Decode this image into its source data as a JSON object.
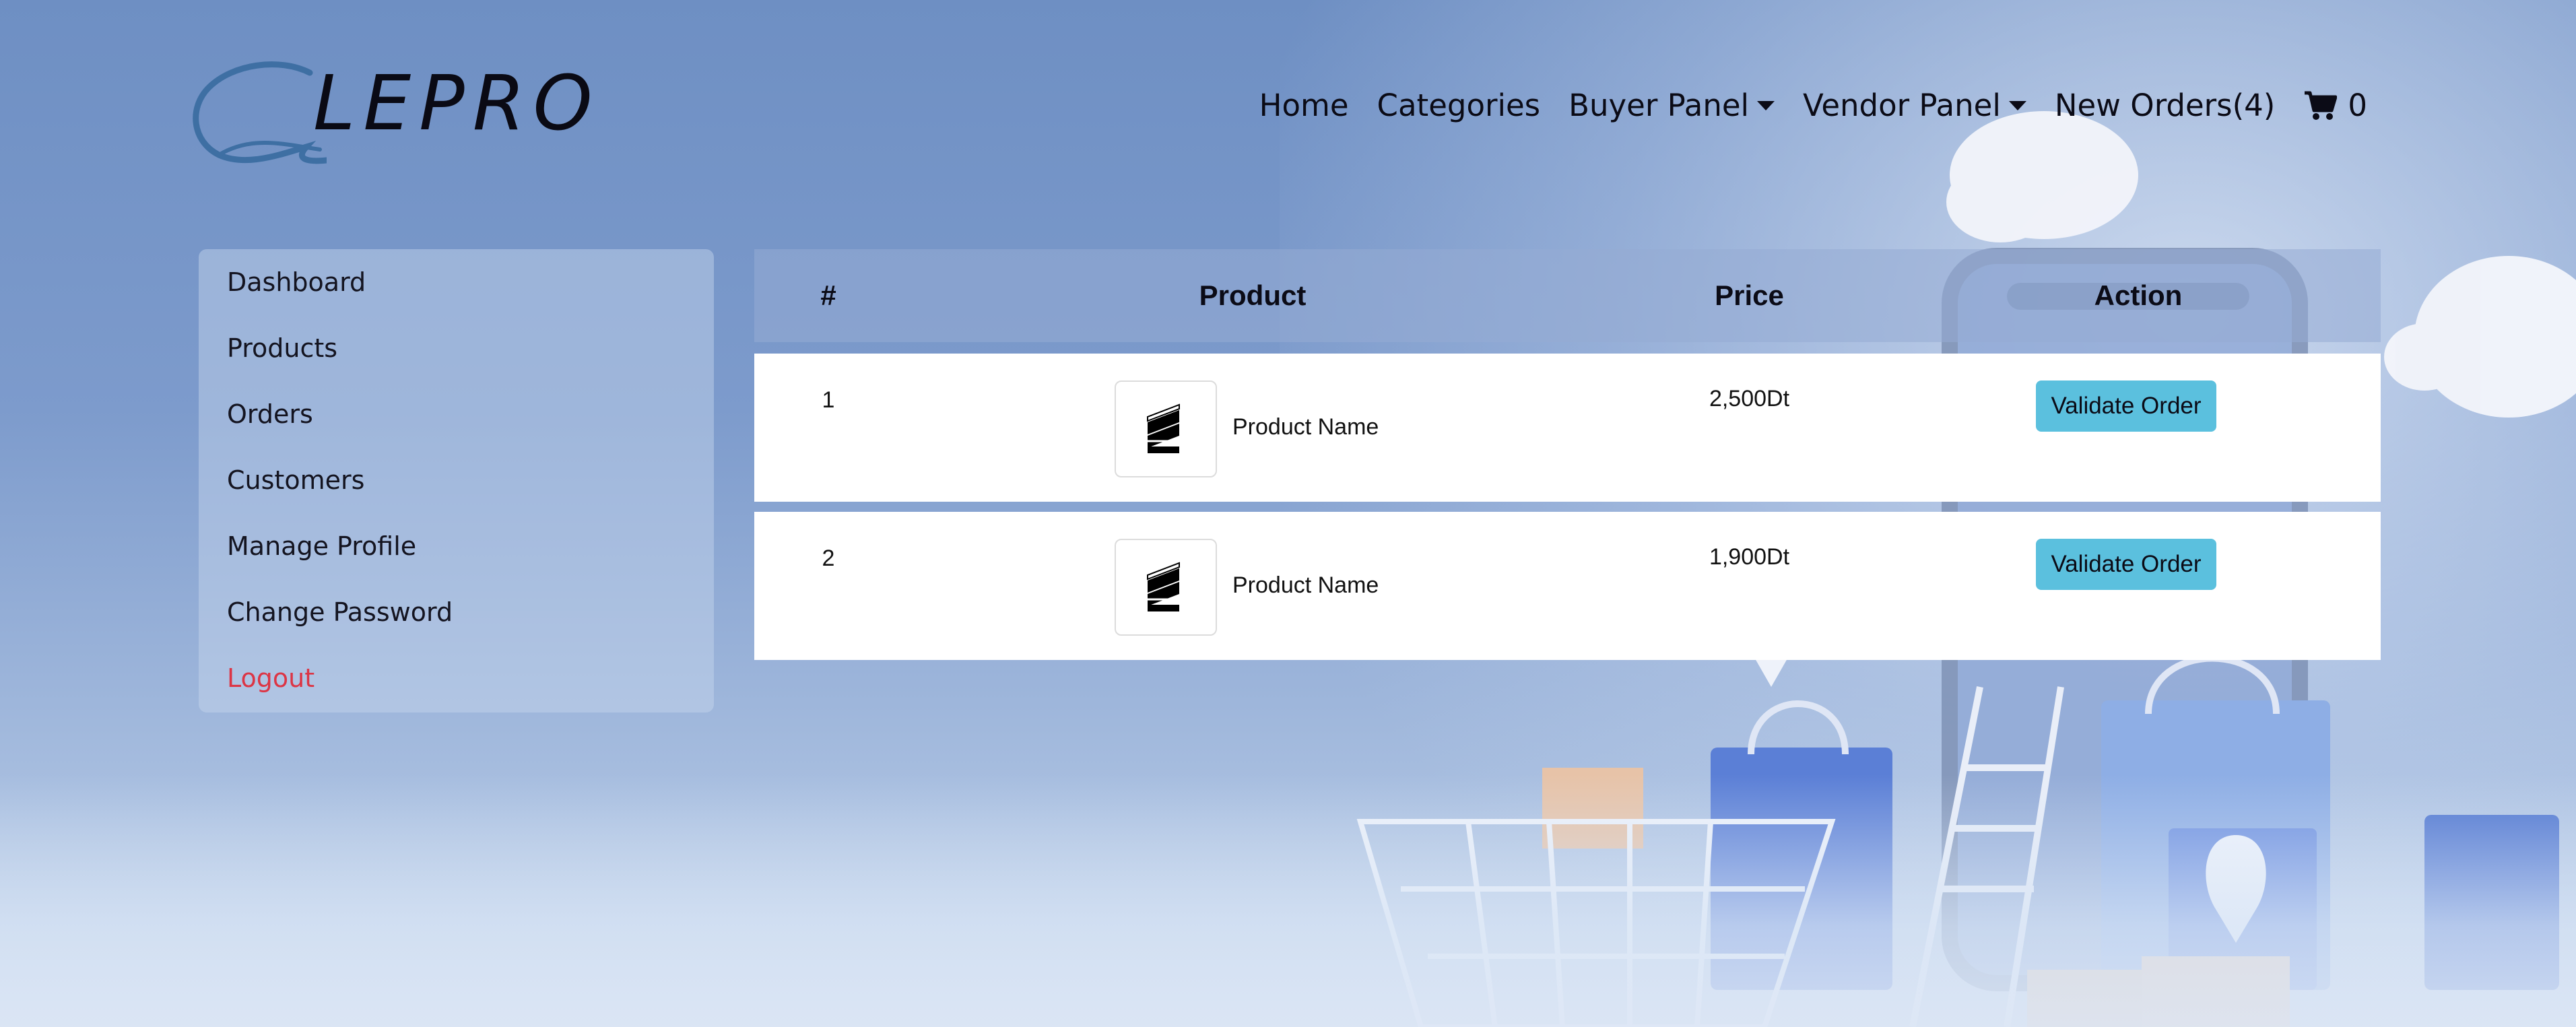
{
  "brand": {
    "name": "LEPRO"
  },
  "nav": {
    "home": "Home",
    "categories": "Categories",
    "buyer_panel": "Buyer Panel",
    "vendor_panel": "Vendor Panel",
    "new_orders": "New Orders(4)",
    "cart_count": "0"
  },
  "sidebar": {
    "items": [
      {
        "label": "Dashboard"
      },
      {
        "label": "Products"
      },
      {
        "label": "Orders"
      },
      {
        "label": "Customers"
      },
      {
        "label": "Manage Profile"
      },
      {
        "label": "Change Password"
      },
      {
        "label": "Logout"
      }
    ]
  },
  "table": {
    "headers": {
      "num": "#",
      "product": "Product",
      "price": "Price",
      "action": "Action"
    },
    "rows": [
      {
        "num": "1",
        "product": "Product Name",
        "price": "2,500Dt",
        "action": "Validate Order"
      },
      {
        "num": "2",
        "product": "Product Name",
        "price": "1,900Dt",
        "action": "Validate Order"
      }
    ]
  },
  "colors": {
    "accent_button": "#5bc0de",
    "logout": "#dc3545",
    "background": "#7d9bcc"
  },
  "icons": [
    "shopping-cart-icon",
    "dropdown-caret-icon",
    "product-thumbnail-icon"
  ]
}
